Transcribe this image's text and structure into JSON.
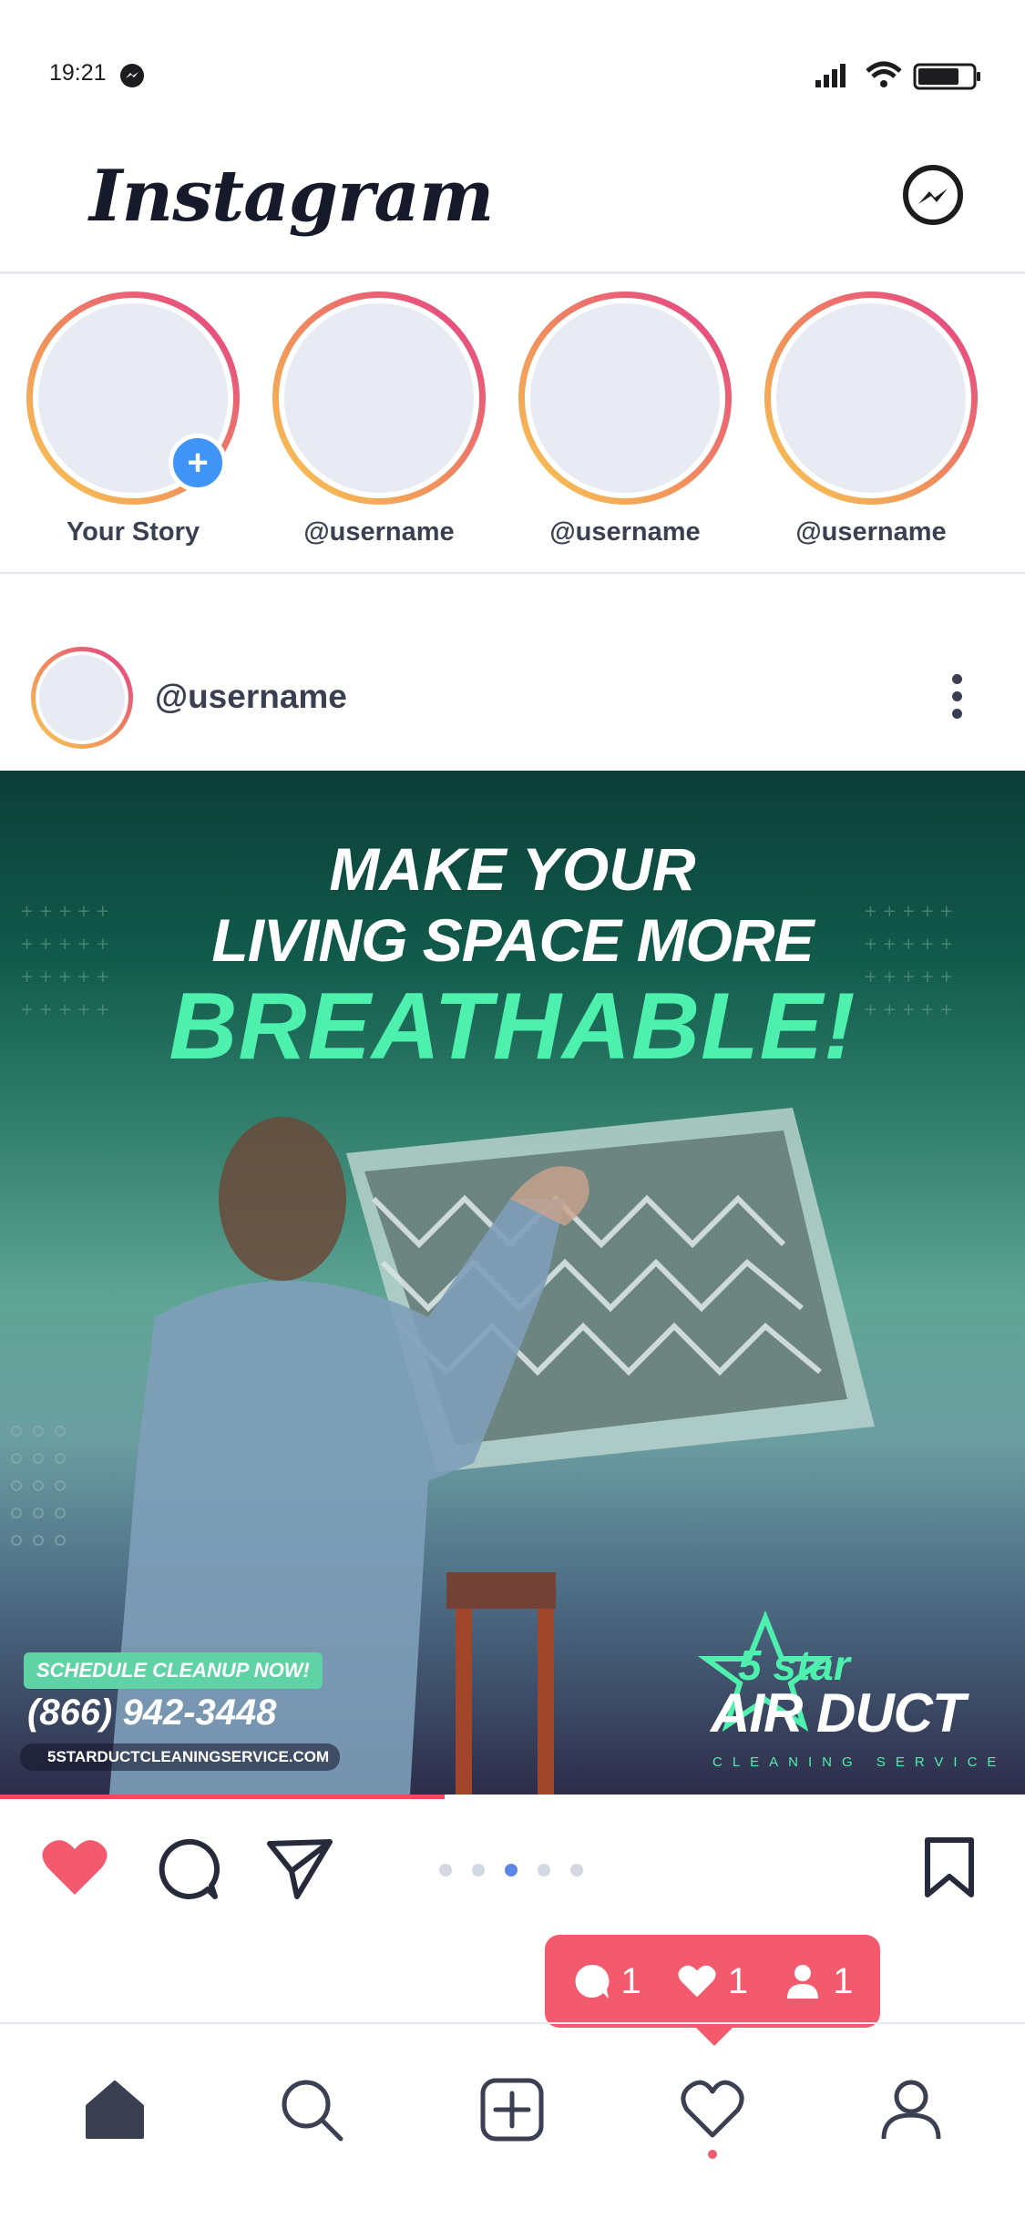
{
  "status_bar": {
    "time": "19:21"
  },
  "header": {
    "logo": "Instagram"
  },
  "stories": [
    {
      "label": "Your Story",
      "has_add": true
    },
    {
      "label": "@username",
      "has_add": false
    },
    {
      "label": "@username",
      "has_add": false
    },
    {
      "label": "@username",
      "has_add": false
    }
  ],
  "post": {
    "username": "@username",
    "ad": {
      "line1": "MAKE YOUR",
      "line2": "LIVING SPACE MORE",
      "line3": "BREATHABLE!",
      "cta": "SCHEDULE CLEANUP NOW!",
      "phone": "(866) 942-3448",
      "website": "5STARDUCTCLEANINGSERVICE.COM",
      "brand_top": "5 star",
      "brand": "AIR DUCT",
      "brand_sub": "CLEANING SERVICE"
    },
    "carousel": {
      "count": 5,
      "active_index": 2
    }
  },
  "notification": {
    "comments": "1",
    "likes": "1",
    "followers": "1"
  },
  "colors": {
    "accent": "#f45a6e",
    "badge_blue": "#3f95f5",
    "ad_green": "#4ef0ad"
  },
  "nav": [
    "home-icon",
    "search-icon",
    "add-icon",
    "heart-icon",
    "profile-icon"
  ]
}
